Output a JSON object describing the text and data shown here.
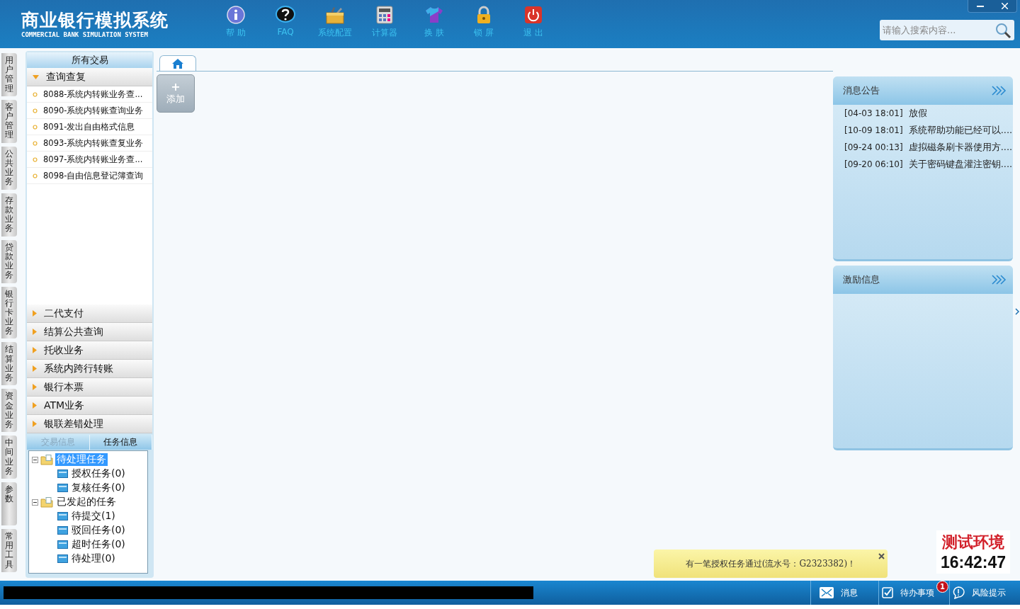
{
  "header": {
    "title": "商业银行模拟系统",
    "subtitle": "COMMERCIAL BANK SIMULATION SYSTEM",
    "toolbar": [
      {
        "kind": "help",
        "label": "帮 助"
      },
      {
        "kind": "faq",
        "label": "FAQ"
      },
      {
        "kind": "config",
        "label": "系统配置"
      },
      {
        "kind": "calculator",
        "label": "计算器"
      },
      {
        "kind": "skin",
        "label": "换 肤"
      },
      {
        "kind": "lock",
        "label": "锁 屏"
      },
      {
        "kind": "exit",
        "label": "退 出"
      }
    ],
    "search": {
      "placeholder": "请输入搜索内容..."
    }
  },
  "side_tabs": [
    {
      "label": "用户管理"
    },
    {
      "label": "客户管理"
    },
    {
      "label": "公共业务"
    },
    {
      "label": "存款业务"
    },
    {
      "label": "贷款业务"
    },
    {
      "label": "银行卡业务"
    },
    {
      "label": "结算业务"
    },
    {
      "label": "资金业务"
    },
    {
      "label": "中间业务"
    },
    {
      "label": "参数"
    },
    {
      "label": "常用工具"
    }
  ],
  "sidebar": {
    "title": "所有交易",
    "sections": [
      {
        "label": "查询查复",
        "expanded": true,
        "items": [
          "8088-系统内转账业务查...",
          "8090-系统内转账查询业务",
          "8091-发出自由格式信息",
          "8093-系统内转账查复业务",
          "8097-系统内转账业务查...",
          "8098-自由信息登记簿查询"
        ]
      },
      {
        "label": "二代支付",
        "expanded": false
      },
      {
        "label": "结算公共查询",
        "expanded": false
      },
      {
        "label": "托收业务",
        "expanded": false
      },
      {
        "label": "系统内跨行转账",
        "expanded": false
      },
      {
        "label": "银行本票",
        "expanded": false
      },
      {
        "label": "ATM业务",
        "expanded": false
      },
      {
        "label": "银联差错处理",
        "expanded": false
      }
    ],
    "tabs": [
      {
        "label": "交易信息",
        "selected": false
      },
      {
        "label": "任务信息",
        "selected": true
      }
    ],
    "tree": [
      {
        "label": "待处理任务",
        "expanded": true,
        "selected": true,
        "children": [
          {
            "label": "授权任务(0)",
            "selected": false
          },
          {
            "label": "复核任务(0)",
            "selected": false
          }
        ]
      },
      {
        "label": "已发起的任务",
        "expanded": true,
        "selected": false,
        "children": [
          {
            "label": "待提交(1)",
            "selected": false
          },
          {
            "label": "驳回任务(0)",
            "selected": false
          },
          {
            "label": "超时任务(0)",
            "selected": false
          },
          {
            "label": "待处理(0)",
            "selected": false
          }
        ]
      }
    ]
  },
  "main": {
    "add_button": {
      "icon": "+",
      "label": "添加"
    }
  },
  "panels": [
    {
      "title": "消息公告",
      "items": [
        {
          "time": "[04-03 18:01]",
          "text": "放假"
        },
        {
          "time": "[10-09 18:01]",
          "text": "系统帮助功能已经可以...."
        },
        {
          "time": "[09-24 00:13]",
          "text": "虚拟磁条刷卡器使用方...."
        },
        {
          "time": "[09-20 06:10]",
          "text": "关于密码键盘灌注密钥...."
        }
      ]
    },
    {
      "title": "激励信息"
    }
  ],
  "toast": {
    "text": "有一笔授权任务通过(流水号：G2323382)！"
  },
  "environment": {
    "label": "测试环境",
    "clock": "16:42:47"
  },
  "status_bar": {
    "buttons": [
      {
        "kind": "message",
        "label": "消息"
      },
      {
        "kind": "todo",
        "label": "待办事项",
        "badge": "1"
      },
      {
        "kind": "risk",
        "label": "风险提示"
      }
    ]
  }
}
